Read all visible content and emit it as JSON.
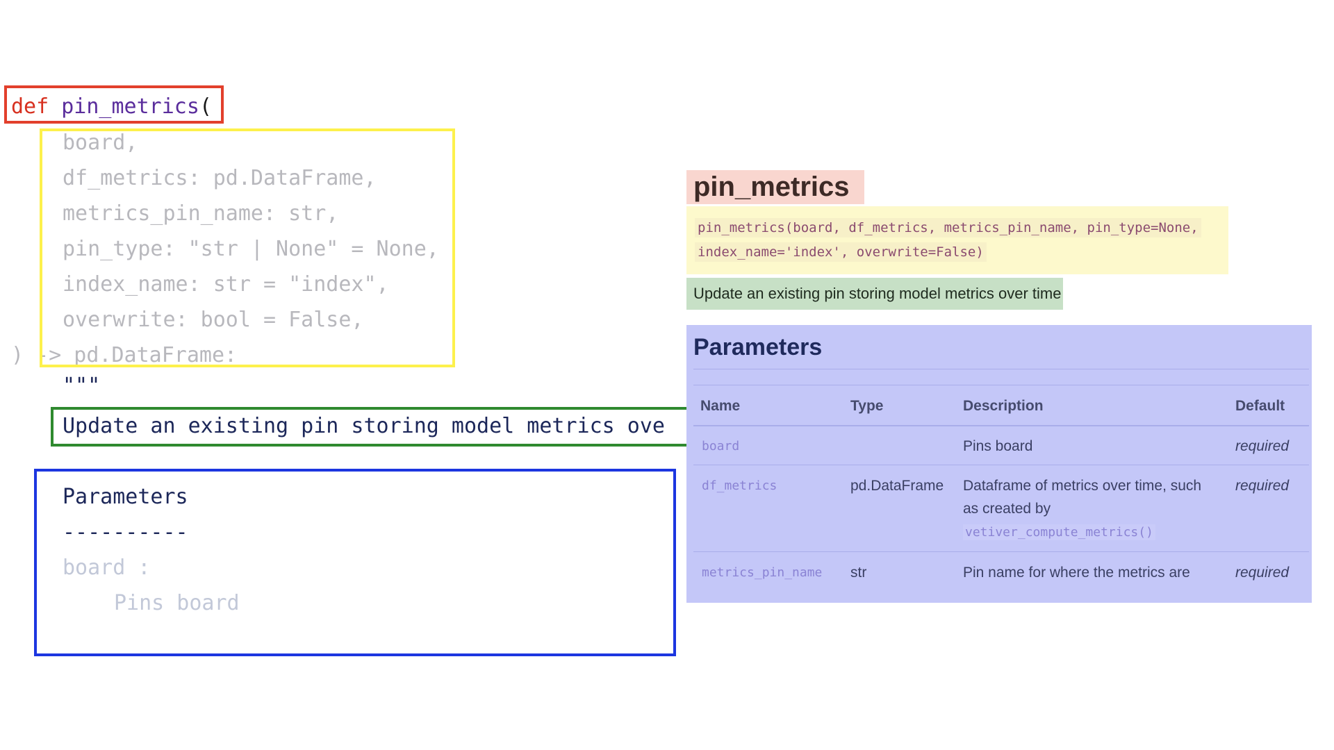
{
  "code": {
    "def_keyword": "def",
    "function_name": "pin_metrics",
    "open_paren": "(",
    "params": [
      "board,",
      "df_metrics: pd.DataFrame,",
      "metrics_pin_name: str,",
      "pin_type: \"str | None\" = None,",
      "index_name: str = \"index\",",
      "overwrite: bool = False,"
    ],
    "return_line": ") -> pd.DataFrame:",
    "docstring_quotes": "\"\"\"",
    "docstring_summary": "Update an existing pin storing model metrics ove",
    "docstring_params_heading": "Parameters",
    "docstring_params_rule": "----------",
    "docstring_param_board": "board :",
    "docstring_param_board_desc": "Pins board"
  },
  "docs": {
    "title": "pin_metrics",
    "signature_line1": "pin_metrics(board, df_metrics, metrics_pin_name, pin_type=None,",
    "signature_line2": "index_name='index', overwrite=False)",
    "summary": "Update an existing pin storing model metrics over time",
    "parameters_heading": "Parameters",
    "table_headers": [
      "Name",
      "Type",
      "Description",
      "Default"
    ],
    "rows": [
      {
        "name": "board",
        "type": "",
        "description": "Pins board",
        "code": "",
        "default": "required"
      },
      {
        "name": "df_metrics",
        "type": "pd.DataFrame",
        "description": "Dataframe of metrics over time, such as created by",
        "code": "vetiver_compute_metrics()",
        "default": "required"
      },
      {
        "name": "metrics_pin_name",
        "type": "str",
        "description": "Pin name for where the metrics are",
        "code": "",
        "default": "required"
      }
    ]
  },
  "colors": {
    "red_box": "#e2402c",
    "yellow_box": "#fdf14c",
    "green_box": "#2f8a2f",
    "blue_box": "#1c36e0",
    "title_bg": "#f9d6cf",
    "signature_bg": "#fdf9cc",
    "summary_bg": "#c7e0c6",
    "parameters_bg": "#c4c7f8"
  }
}
